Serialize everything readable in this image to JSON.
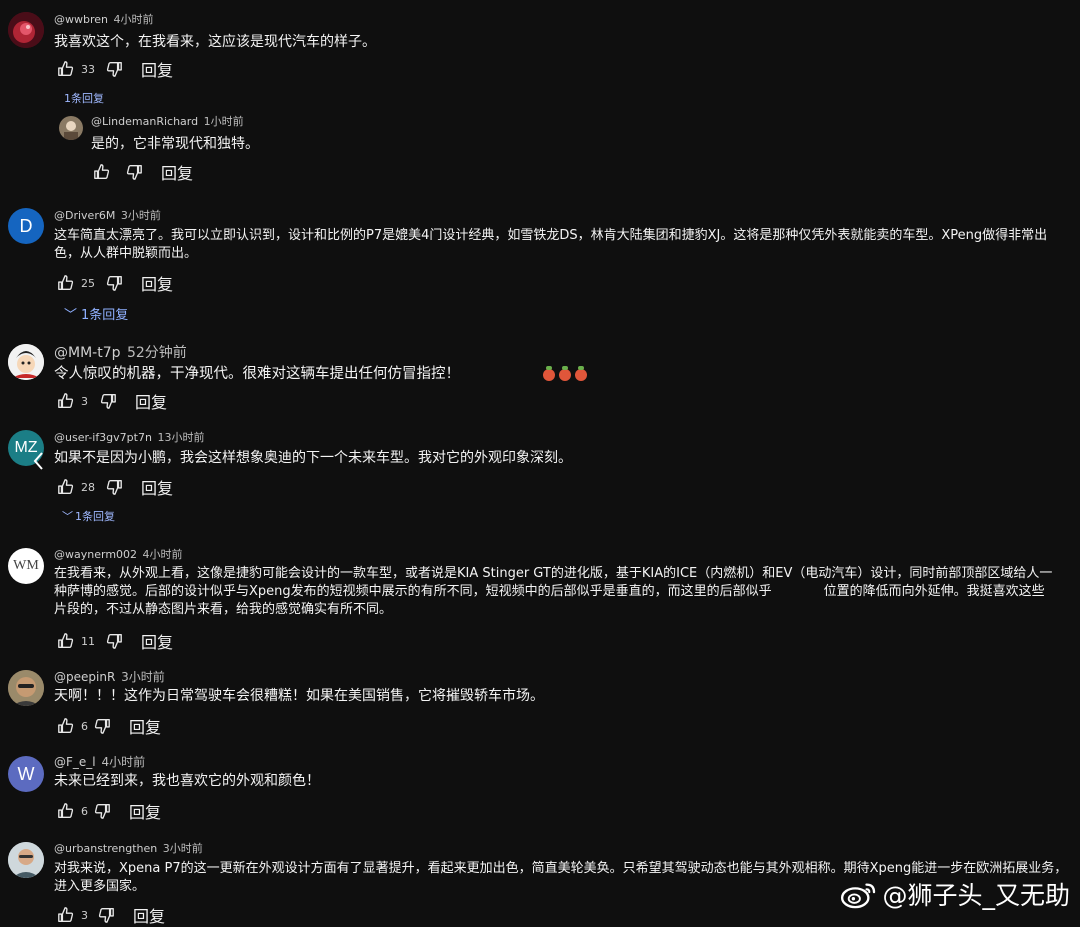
{
  "reply_label": "回复",
  "comments": [
    {
      "author": "@wwbren",
      "time": "4小时前",
      "text": "我喜欢这个，在我看来，这应该是现代汽车的样子。",
      "likes": "33",
      "replies_toggle": "1条回复",
      "reply": {
        "author": "@LindemanRichard",
        "time": "1小时前",
        "text": "是的，它非常现代和独特。",
        "likes": ""
      }
    },
    {
      "author": "@Driver6M",
      "time": "3小时前",
      "avatar_letter": "D",
      "text": "这车简直太漂亮了。我可以立即认识到，设计和比例的P7是媲美4门设计经典，如雪铁龙DS，林肯大陆集团和捷豹XJ。这将是那种仅凭外表就能卖的车型。XPeng做得非常出色，从人群中脱颖而出。",
      "likes": "25",
      "replies_toggle": "1条回复"
    },
    {
      "author": "@MM-t7p",
      "time": "52分钟前",
      "text": "令人惊叹的机器，干净现代。很难对这辆车提出任何仿冒指控！",
      "likes": "3"
    },
    {
      "author": "@user-if3gv7pt7n",
      "time": "13小时前",
      "avatar_letter": "MZ",
      "text": "如果不是因为小鹏，我会这样想象奥迪的下一个未来车型。我对它的外观印象深刻。",
      "likes": "28",
      "replies_toggle": "1条回复"
    },
    {
      "author": "@waynerm002",
      "time": "4小时前",
      "avatar_letter": "WM",
      "text": "在我看来，从外观上看，这像是捷豹可能会设计的一款车型，或者说是KIA Stinger GT的进化版，基于KIA的ICE（内燃机）和EV（电动汽车）设计，同时前部顶部区域给人一种萨博的感觉。后部的设计似乎与Xpeng发布的短视频中展示的有所不同，短视频中的后部似乎是垂直的，而这里的后部似乎　　　　位置的降低而向外延伸。我挺喜欢这些片段的，不过从静态图片来看，给我的感觉确实有所不同。",
      "likes": "11"
    },
    {
      "author": "@peepinR",
      "time": "3小时前",
      "text": "天啊！！！这作为日常驾驶车会很糟糕！如果在美国销售，它将摧毁轿车市场。",
      "likes": "6"
    },
    {
      "author": "@F_e_l",
      "time": "4小时前",
      "avatar_letter": "W",
      "text": "未来已经到来，我也喜欢它的外观和颜色！",
      "likes": "6"
    },
    {
      "author": "@urbanstrengthen",
      "time": "3小时前",
      "text": "对我来说，Xpena P7的这一更新在外观设计方面有了显著提升，看起来更加出色，简直美轮美奂。只希望其驾驶动态也能与其外观相称。期待Xpeng能进一步在欧洲拓展业务，进入更多国家。",
      "likes": "3"
    }
  ],
  "watermark": "@狮子头_又无助",
  "colors": {
    "background": "#0f0f0f",
    "link": "#9bb4ff",
    "avatar_driver": "#1565c0",
    "avatar_fel": "#5c6bc0"
  }
}
